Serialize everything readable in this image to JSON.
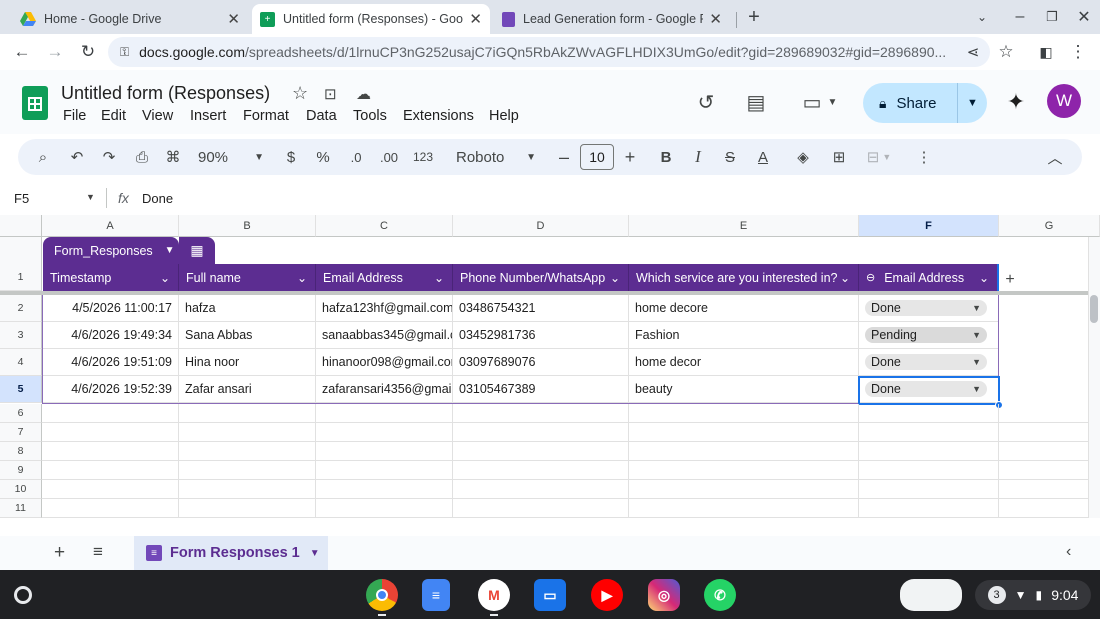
{
  "browser": {
    "tabs": [
      {
        "title": "Home - Google Drive",
        "active": false
      },
      {
        "title": "Untitled form (Responses) - Goo",
        "active": true
      },
      {
        "title": "Lead Generation form - Google F",
        "active": false
      }
    ],
    "new_tab": "+",
    "url_host": "docs.google.com",
    "url_path": "/spreadsheets/d/1lrnuCP3nG252usajC7iGQn5RbAkZWvAGFLHDIX3UmGo/edit?gid=289689032#gid=2896890..."
  },
  "doc": {
    "title": "Untitled form (Responses)",
    "menu": [
      "File",
      "Edit",
      "View",
      "Insert",
      "Format",
      "Data",
      "Tools",
      "Extensions",
      "Help"
    ],
    "share_label": "Share",
    "avatar_letter": "W"
  },
  "toolbar": {
    "zoom": "90%",
    "currency": "$",
    "percent": "%",
    "dec_decrease": ".0",
    "dec_increase": ".00",
    "number_format": "123",
    "font": "Roboto",
    "font_size": "10"
  },
  "formula_bar": {
    "cell_ref": "F5",
    "fx": "fx",
    "value": "Done"
  },
  "grid": {
    "columns": [
      "A",
      "B",
      "C",
      "D",
      "E",
      "F",
      "G"
    ],
    "selected_column": "F",
    "table_name": "Form_Responses",
    "headers": [
      "Timestamp",
      "Full name",
      "Email Address",
      "Phone Number/WhatsApp",
      "Which service are you interested in?",
      "Email Address"
    ],
    "rows": [
      {
        "num": "2",
        "timestamp": "4/5/2026 11:00:17",
        "name": "hafza",
        "email": "hafza123hf@gmail.com",
        "phone": "03486754321",
        "service": "home decore",
        "status": "Done"
      },
      {
        "num": "3",
        "timestamp": "4/6/2026 19:49:34",
        "name": "Sana Abbas",
        "email": "sanaabbas345@gmail.c",
        "phone": "03452981736",
        "service": "Fashion",
        "status": "Pending"
      },
      {
        "num": "4",
        "timestamp": "4/6/2026 19:51:09",
        "name": "Hina noor",
        "email": "hinanoor098@gmail.cor",
        "phone": "03097689076",
        "service": "home decor",
        "status": "Done"
      },
      {
        "num": "5",
        "timestamp": "4/6/2026 19:52:39",
        "name": "Zafar ansari",
        "email": "zafaransari4356@gmail.",
        "phone": "03105467389",
        "service": "beauty",
        "status": "Done"
      }
    ],
    "empty_rows": [
      "6",
      "7",
      "8",
      "9",
      "10",
      "11"
    ],
    "header_row_num": "1",
    "selected_row": "5",
    "status_colors": {
      "Done": "#e6e6e6",
      "Pending": "#e6e6e6"
    }
  },
  "sheets": {
    "active": "Form Responses 1",
    "add": "+"
  },
  "shelf": {
    "apps": [
      {
        "name": "Chrome",
        "color": "#ea4335"
      },
      {
        "name": "Docs",
        "color": "#4285f4"
      },
      {
        "name": "Gmail",
        "color": "#ffffff"
      },
      {
        "name": "Files",
        "color": "#1a73e8"
      },
      {
        "name": "YouTube",
        "color": "#ff0000"
      },
      {
        "name": "Instagram",
        "color": "#d62976"
      },
      {
        "name": "WhatsApp",
        "color": "#25d366"
      }
    ],
    "notification_count": "3",
    "time": "9:04"
  },
  "colors": {
    "table_header": "#5c2d91",
    "selection": "#1a73e8",
    "share_bg": "#c2e7ff"
  }
}
